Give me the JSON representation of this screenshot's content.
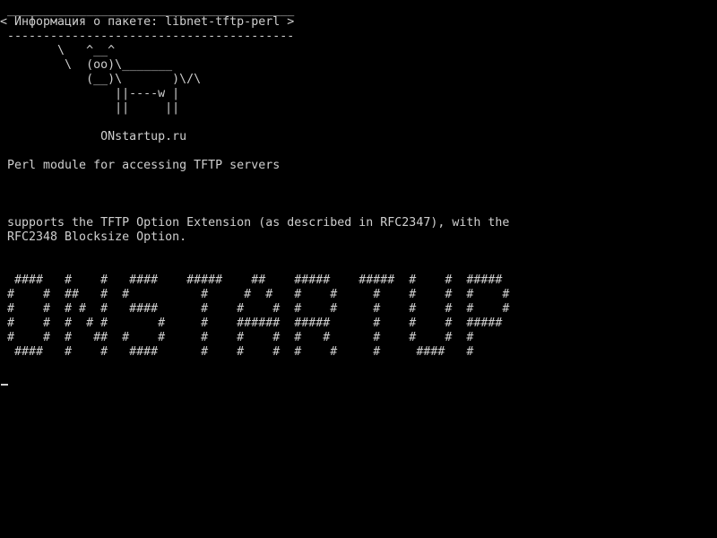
{
  "terminal": {
    "lines": [
      " ________________________________________",
      "< Информация о пакете: libnet-tftp-perl >",
      " ----------------------------------------",
      "        \\   ^__^",
      "         \\  (oo)\\_______",
      "            (__)\\       )\\/\\",
      "                ||----w |",
      "                ||     ||",
      "",
      "              ONstartup.ru",
      "",
      " Perl module for accessing TFTP servers",
      "",
      "",
      "",
      " supports the TFTP Option Extension (as described in RFC2347), with the",
      " RFC2348 Blocksize Option.",
      "",
      "",
      "  ####   #    #   ####    #####    ##    #####    #####  #    #  #####",
      " #    #  ##   #  #          #     #  #   #    #     #    #    #  #    #",
      " #    #  # #  #   ####      #    #    #  #    #     #    #    #  #    #",
      " #    #  #  # #       #     #    ######  #####      #    #    #  #####",
      " #    #  #   ##  #    #     #    #    #  #   #      #    #    #  #",
      "  ####   #    #   ####      #    #    #  #    #     #     ####   #"
    ],
    "fg_color": "#cfcfcf",
    "bg_color": "#000000"
  }
}
